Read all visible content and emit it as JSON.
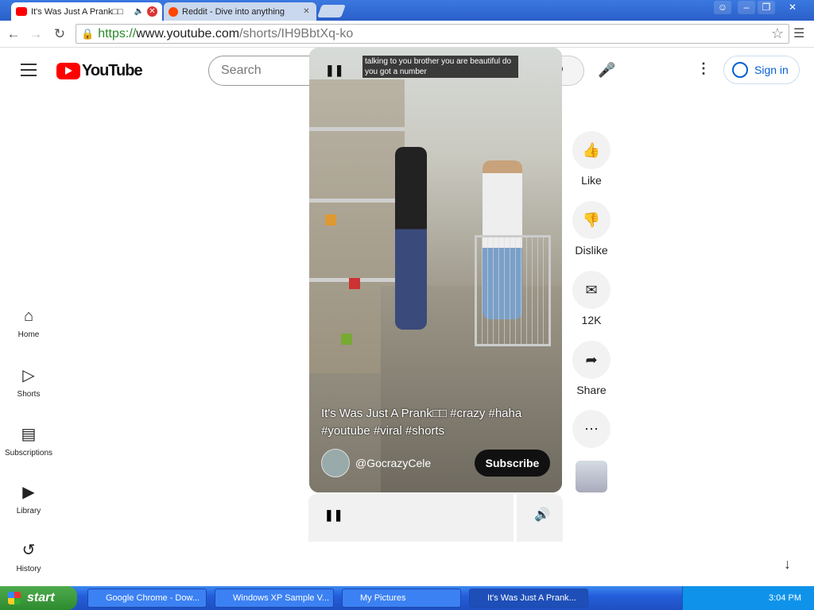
{
  "browser": {
    "tabs": [
      {
        "label": "It's Was Just A Prank□□",
        "favicon": "youtube-icon"
      },
      {
        "label": "Reddit - Dive into anything",
        "favicon": "reddit-icon"
      }
    ],
    "url_scheme": "https://",
    "url_host": "www.youtube.com",
    "url_path": "/shorts/IH9BbtXq-ko"
  },
  "youtube": {
    "logo": "YouTube",
    "search_placeholder": "Search",
    "signin": "Sign in",
    "sidebar": [
      "Home",
      "Shorts",
      "Subscriptions",
      "Library",
      "History"
    ],
    "caption": "talking to you brother you are beautiful do you got a number",
    "video_title": "It's Was Just A Prank□□ #crazy #haha #youtube #viral #shorts",
    "channel": "@GocrazyCele",
    "subscribe": "Subscribe",
    "actions": {
      "like": "Like",
      "dislike": "Dislike",
      "comments": "12K",
      "share": "Share"
    }
  },
  "taskbar": {
    "start": "start",
    "tasks": [
      "Google Chrome - Dow...",
      "Windows XP Sample V...",
      "My Pictures",
      "It's Was Just A Prank..."
    ],
    "clock": "3:04 PM"
  },
  "colors": {
    "brand": "#ff0000",
    "link": "#065fd4",
    "xp_blue": "#245edb",
    "xp_green": "#2e8a2e"
  }
}
